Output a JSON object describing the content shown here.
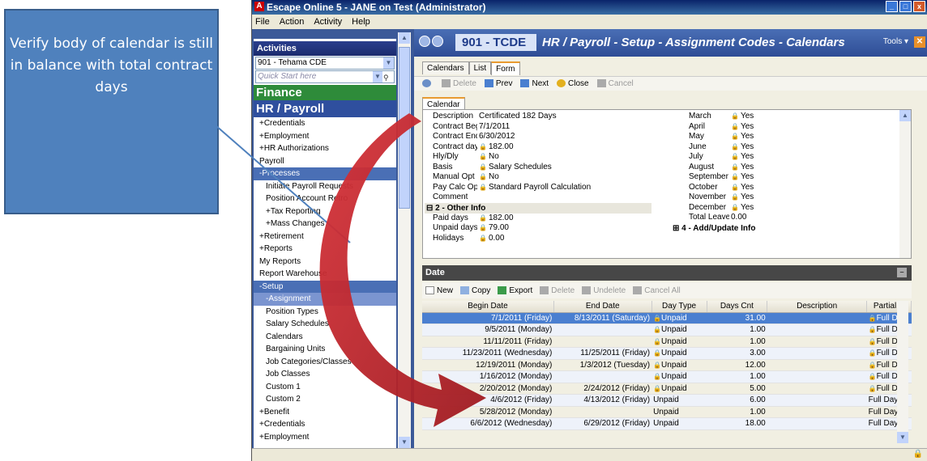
{
  "callout": {
    "text": "Verify body of calendar is still in balance with total contract days"
  },
  "window": {
    "title": "Escape Online 5 - JANE on Test (Administrator)",
    "logo": "A",
    "buttons": {
      "minimize": "_",
      "maximize": "□",
      "close": "x"
    }
  },
  "menu": [
    "File",
    "Action",
    "Activity",
    "Help"
  ],
  "sidebar": {
    "header": "Activities",
    "district": "901 - Tehama CDE",
    "quick_start_placeholder": "Quick Start here",
    "finance": "Finance",
    "hr": "HR / Payroll",
    "items": [
      {
        "label": "+Credentials",
        "level": "l2",
        "state": ""
      },
      {
        "label": "+Employment",
        "level": "l2",
        "state": ""
      },
      {
        "label": "+HR Authorizations",
        "level": "l2",
        "state": ""
      },
      {
        "label": "Payroll",
        "level": "l2",
        "state": ""
      },
      {
        "label": "-Processes",
        "level": "l2",
        "state": "sel1"
      },
      {
        "label": "Initiate Payroll Requests",
        "level": "l3",
        "state": ""
      },
      {
        "label": "Position Account Retro",
        "level": "l3",
        "state": ""
      },
      {
        "label": "+Tax Reporting",
        "level": "l3",
        "state": ""
      },
      {
        "label": "+Mass Changes",
        "level": "l3",
        "state": ""
      },
      {
        "label": "+Retirement",
        "level": "l2",
        "state": ""
      },
      {
        "label": "+Reports",
        "level": "l2",
        "state": ""
      },
      {
        "label": "My Reports",
        "level": "l2",
        "state": ""
      },
      {
        "label": "Report Warehouse",
        "level": "l2",
        "state": ""
      },
      {
        "label": "-Setup",
        "level": "l2",
        "state": "sel1"
      },
      {
        "label": "-Assignment",
        "level": "l3",
        "state": "sel2"
      },
      {
        "label": "Position Types",
        "level": "l3",
        "state": ""
      },
      {
        "label": "Salary Schedules",
        "level": "l3",
        "state": ""
      },
      {
        "label": "Calendars",
        "level": "l3",
        "state": ""
      },
      {
        "label": "Bargaining Units",
        "level": "l3",
        "state": ""
      },
      {
        "label": "Job Categories/Classes",
        "level": "l3",
        "state": ""
      },
      {
        "label": "Job Classes",
        "level": "l3",
        "state": ""
      },
      {
        "label": "Custom 1",
        "level": "l3",
        "state": ""
      },
      {
        "label": "Custom 2",
        "level": "l3",
        "state": ""
      },
      {
        "label": "+Benefit",
        "level": "l2",
        "state": ""
      },
      {
        "label": "+Credentials",
        "level": "l2",
        "state": ""
      },
      {
        "label": "+Employment",
        "level": "l2",
        "state": ""
      }
    ]
  },
  "main": {
    "code": "901 - TCDE",
    "title": "HR / Payroll - Setup - Assignment Codes - Calendars",
    "tools": "Tools ▾",
    "tabs": [
      "Calendars",
      "List",
      "Form"
    ],
    "toolbar": {
      "delete": "Delete",
      "prev": "Prev",
      "next": "Next",
      "close": "Close",
      "cancel": "Cancel"
    },
    "subtab": "Calendar"
  },
  "form_left": [
    {
      "label": "Description",
      "value": "Certificated 182 Days",
      "lock": false
    },
    {
      "label": "Contract Begin",
      "value": "7/1/2011",
      "lock": false
    },
    {
      "label": "Contract End D",
      "value": "6/30/2012",
      "lock": false
    },
    {
      "label": "Contract days",
      "value": "182.00",
      "lock": true
    },
    {
      "label": "Hly/Dly",
      "value": "No",
      "lock": true
    },
    {
      "label": "Basis",
      "value": "Salary Schedules",
      "lock": true
    },
    {
      "label": "Manual Opt",
      "value": "No",
      "lock": true
    },
    {
      "label": "Pay Calc Opt",
      "value": "Standard Payroll Calculation",
      "lock": true
    },
    {
      "label": "Comment",
      "value": "",
      "lock": false
    }
  ],
  "group2": "2 - Other Info",
  "form_left2": [
    {
      "label": "Paid days",
      "value": "182.00",
      "lock": true
    },
    {
      "label": "Unpaid days",
      "value": "79.00",
      "lock": true
    },
    {
      "label": "Holidays",
      "value": "0.00",
      "lock": true
    }
  ],
  "form_right": [
    {
      "label": "March",
      "value": "Yes"
    },
    {
      "label": "April",
      "value": "Yes"
    },
    {
      "label": "May",
      "value": "Yes"
    },
    {
      "label": "June",
      "value": "Yes"
    },
    {
      "label": "July",
      "value": "Yes"
    },
    {
      "label": "August",
      "value": "Yes"
    },
    {
      "label": "September",
      "value": "Yes"
    },
    {
      "label": "October",
      "value": "Yes"
    },
    {
      "label": "November",
      "value": "Yes"
    },
    {
      "label": "December",
      "value": "Yes"
    }
  ],
  "total_leave": {
    "label": "Total Leave M",
    "value": "0.00"
  },
  "group4": "4 - Add/Update Info",
  "date_section": {
    "title": "Date",
    "toolbar": {
      "new": "New",
      "copy": "Copy",
      "export": "Export",
      "delete": "Delete",
      "undelete": "Undelete",
      "cancel_all": "Cancel All"
    },
    "columns": [
      "Begin Date",
      "End Date",
      "Day Type",
      "Days Cnt",
      "Description",
      "Partial D"
    ],
    "rows": [
      {
        "begin": "7/1/2011 (Friday)",
        "end": "8/13/2011 (Saturday)",
        "type": "Unpaid",
        "days": "31.00",
        "desc": "",
        "partial": "Full Day",
        "locked": true
      },
      {
        "begin": "9/5/2011 (Monday)",
        "end": "",
        "type": "Unpaid",
        "days": "1.00",
        "desc": "",
        "partial": "Full Day",
        "locked": true
      },
      {
        "begin": "11/11/2011 (Friday)",
        "end": "",
        "type": "Unpaid",
        "days": "1.00",
        "desc": "",
        "partial": "Full Day",
        "locked": true
      },
      {
        "begin": "11/23/2011 (Wednesday)",
        "end": "11/25/2011 (Friday)",
        "type": "Unpaid",
        "days": "3.00",
        "desc": "",
        "partial": "Full Day",
        "locked": true
      },
      {
        "begin": "12/19/2011 (Monday)",
        "end": "1/3/2012 (Tuesday)",
        "type": "Unpaid",
        "days": "12.00",
        "desc": "",
        "partial": "Full Day",
        "locked": true
      },
      {
        "begin": "1/16/2012 (Monday)",
        "end": "",
        "type": "Unpaid",
        "days": "1.00",
        "desc": "",
        "partial": "Full Day",
        "locked": true
      },
      {
        "begin": "2/20/2012 (Monday)",
        "end": "2/24/2012 (Friday)",
        "type": "Unpaid",
        "days": "5.00",
        "desc": "",
        "partial": "Full Day",
        "locked": true
      },
      {
        "begin": "4/6/2012 (Friday)",
        "end": "4/13/2012 (Friday)",
        "type": "Unpaid",
        "days": "6.00",
        "desc": "",
        "partial": "Full Day",
        "locked": false
      },
      {
        "begin": "5/28/2012 (Monday)",
        "end": "",
        "type": "Unpaid",
        "days": "1.00",
        "desc": "",
        "partial": "Full Day",
        "locked": false
      },
      {
        "begin": "6/6/2012 (Wednesday)",
        "end": "6/29/2012 (Friday)",
        "type": "Unpaid",
        "days": "18.00",
        "desc": "",
        "partial": "Full Day",
        "locked": false
      }
    ]
  },
  "colors": {
    "arrow": "#C0272D",
    "callout": "#4F81BD",
    "finance": "#2E8B3A",
    "hr": "#2F4F9E",
    "selected_row": "#4A7FD0"
  },
  "icons": [
    "search-icon",
    "lock-icon",
    "arrow-left-icon",
    "arrow-right-icon",
    "close-icon"
  ]
}
